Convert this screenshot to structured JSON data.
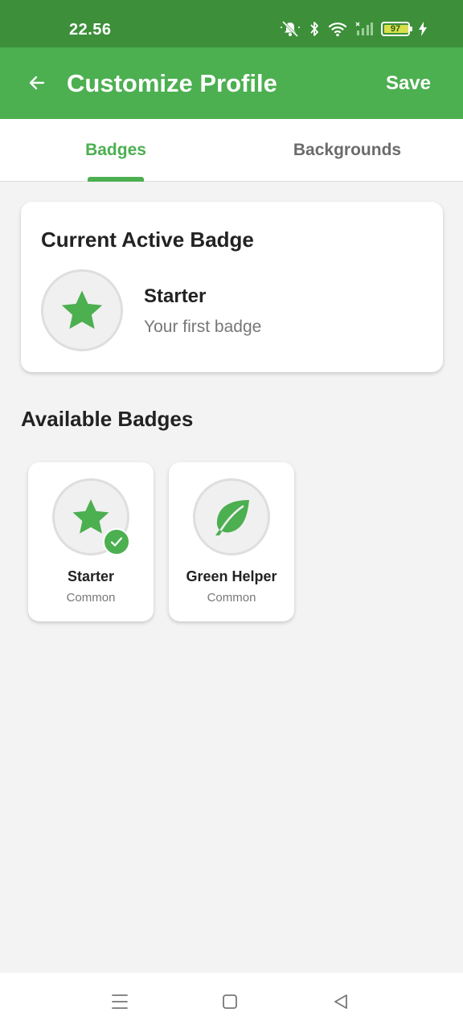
{
  "status_bar": {
    "time": "22.56",
    "battery": "97",
    "icons": [
      "mute-icon",
      "bluetooth-icon",
      "wifi-icon",
      "signal-icon",
      "battery-icon",
      "charging-icon"
    ]
  },
  "app_bar": {
    "title": "Customize Profile",
    "save_label": "Save",
    "back_icon": "arrow-left-icon"
  },
  "tabs": [
    {
      "label": "Badges",
      "active": true
    },
    {
      "label": "Backgrounds",
      "active": false
    }
  ],
  "active_badge": {
    "heading": "Current Active Badge",
    "name": "Starter",
    "description": "Your first badge",
    "icon": "star-icon"
  },
  "available": {
    "heading": "Available Badges",
    "badges": [
      {
        "name": "Starter",
        "rarity": "Common",
        "icon": "star-icon",
        "selected": true
      },
      {
        "name": "Green Helper",
        "rarity": "Common",
        "icon": "leaf-icon",
        "selected": false
      }
    ]
  },
  "colors": {
    "status_bar": "#3d8f3a",
    "primary": "#4caf50",
    "background": "#f3f3f3",
    "inactive_tab": "#6b6b6b"
  },
  "nav_bar": {
    "icons": [
      "menu-icon",
      "home-icon",
      "back-triangle-icon"
    ]
  }
}
